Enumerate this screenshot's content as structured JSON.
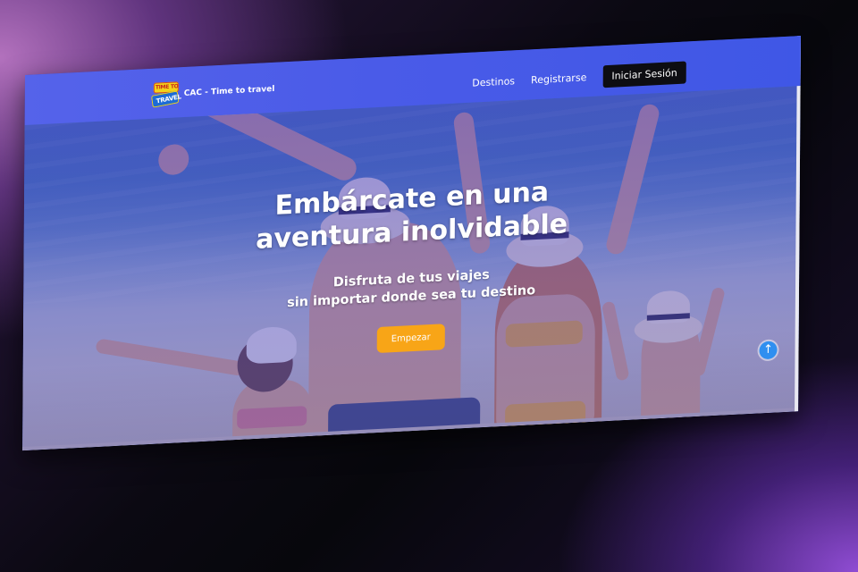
{
  "navbar": {
    "brand_name": "CAC - Time to travel",
    "logo_top_text": "TIME TO",
    "logo_bottom_text": "TRAVEL",
    "links": [
      "Destinos",
      "Registrarse"
    ],
    "login_label": "Iniciar Sesión"
  },
  "hero": {
    "title": "Embárcate en una aventura inolvidable",
    "subtitle_line1": "Disfruta de tus viajes",
    "subtitle_line2": "sin importar donde sea tu destino",
    "cta_label": "Empezar"
  },
  "colors": {
    "navbar": "#4a5be8",
    "overlay": "#4b3cc8",
    "cta": "#f8a517",
    "login_button": "#0d0d12"
  },
  "icons": {
    "scroll_top": "arrow-up-icon"
  }
}
